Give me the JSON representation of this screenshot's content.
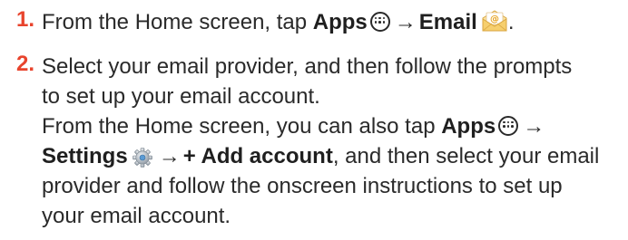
{
  "steps": [
    {
      "number": "1.",
      "prefix": "From the Home screen, tap ",
      "apps_label": "Apps",
      "arrow": "→",
      "email_label": "Email",
      "trailing": "."
    },
    {
      "number": "2.",
      "text_line1": "Select your email provider, and then follow the prompts",
      "text_line2": "to set up your email account.",
      "alt_prefix": "From the Home screen, you can also tap ",
      "alt_apps_label": "Apps",
      "arrow": "→",
      "settings_label": "Settings",
      "add_account_label": "+ Add account",
      "alt_suffix": ", and then select your email",
      "alt_line3": "provider and follow the onscreen instructions to set up",
      "alt_line4": "your email account."
    }
  ],
  "colors": {
    "step_number": "#e8442d",
    "text": "#2a2a2a"
  },
  "icons": {
    "apps": "apps-grid-icon",
    "email": "email-envelope-icon",
    "settings": "settings-gear-icon",
    "arrow": "right-arrow"
  }
}
